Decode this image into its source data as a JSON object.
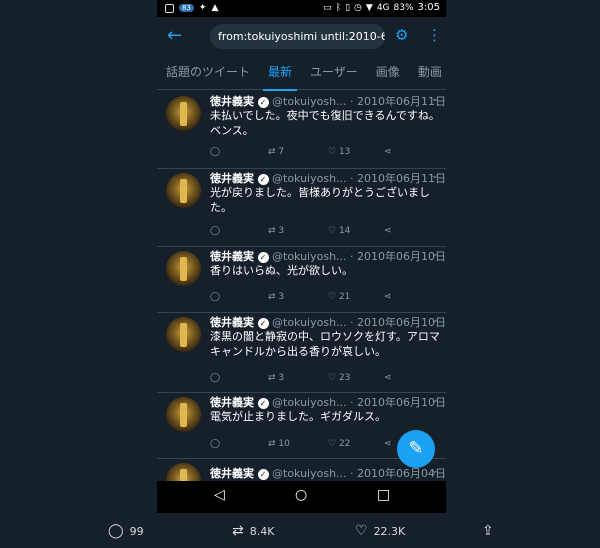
{
  "status": {
    "notif_count": "83",
    "battery": "83%",
    "signal": "4G",
    "time": "3:05"
  },
  "appbar": {
    "back_icon": "arrow-left-icon",
    "search_value": "from:tokuiyoshimi until:2010-6-...",
    "filter_icon": "sliders-icon",
    "more_icon": "vertical-dots-icon"
  },
  "tabs": [
    {
      "label": "話題のツイート"
    },
    {
      "label": "最新"
    },
    {
      "label": "ユーザー"
    },
    {
      "label": "画像"
    },
    {
      "label": "動画"
    }
  ],
  "tweets": [
    {
      "name": "徳井義実",
      "handle": "@tokuiyosh...",
      "date": "· 2010年06月11日",
      "text": "未払いでした。夜中でも復旧できるんですね。ベンス。",
      "replies": "",
      "retweets": "7",
      "likes": "13"
    },
    {
      "name": "徳井義実",
      "handle": "@tokuiyosh...",
      "date": "· 2010年06月11日",
      "text": "光が戻りました。皆様ありがとうございました。",
      "replies": "",
      "retweets": "3",
      "likes": "14"
    },
    {
      "name": "徳井義実",
      "handle": "@tokuiyosh...",
      "date": "· 2010年06月10日",
      "text": "香りはいらぬ、光が欲しい。",
      "replies": "",
      "retweets": "3",
      "likes": "21"
    },
    {
      "name": "徳井義実",
      "handle": "@tokuiyosh...",
      "date": "· 2010年06月10日",
      "text": "漆黒の闇と静寂の中、ロウソクを灯す。アロマキャンドルから出る香りが哀しい。",
      "replies": "",
      "retweets": "3",
      "likes": "23"
    },
    {
      "name": "徳井義実",
      "handle": "@tokuiyosh...",
      "date": "· 2010年06月10日",
      "text": "電気が止まりました。ギガダルス。",
      "replies": "",
      "retweets": "10",
      "likes": "22"
    },
    {
      "name": "徳井義実",
      "handle": "@tokuiyosh...",
      "date": "· 2010年06月04日",
      "text": "",
      "replies": "",
      "retweets": "",
      "likes": ""
    }
  ],
  "footer": {
    "replies": "99",
    "retweets": "8.4K",
    "likes": "22.3K"
  }
}
